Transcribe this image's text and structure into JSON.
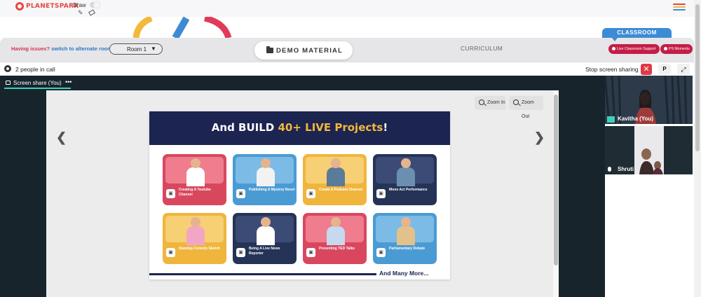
{
  "brand": {
    "name": "PLANETSPARK"
  },
  "toolbar": {
    "draw_label": "Draw"
  },
  "connection": {
    "issue_prefix": "Having issues?",
    "issue_link": "switch to alternate room",
    "room": "Room 1"
  },
  "nav": {
    "demo_material": "DEMO MATERIAL",
    "curriculum": "CURRICULUM",
    "classroom": "CLASSROOM",
    "live_support": "Live Classroom Support",
    "ps_moments": "PS Moments"
  },
  "call": {
    "people_count": "2 people in call",
    "stop_sharing": "Stop screen sharing",
    "p_label": "P"
  },
  "share": {
    "tab_label": "Screen share (You)",
    "more": "•••",
    "zoom_in": "Zoom In",
    "zoom_out": "Zoom Out"
  },
  "slide": {
    "title_prefix": "And BUILD",
    "title_highlight": "40+ LIVE Projects",
    "title_suffix": "!",
    "cards": [
      {
        "label": "Creating A Youtube Channel",
        "bg": "#d9475f",
        "inner": "#ef7d8e",
        "shirt": "#ffffff"
      },
      {
        "label": "Publishing A Mystery Novel",
        "bg": "#4a9bd4",
        "inner": "#7cbbe6",
        "shirt": "#f2f2f2"
      },
      {
        "label": "Create A Podcast Channel",
        "bg": "#f0b53d",
        "inner": "#f7cf74",
        "shirt": "#5a7b9a"
      },
      {
        "label": "Mono Act Performance",
        "bg": "#253357",
        "inner": "#3c4b76",
        "shirt": "#6b8fb0"
      },
      {
        "label": "Standup Comedy Sketch",
        "bg": "#f0b53d",
        "inner": "#f7cf74",
        "shirt": "#f3a6c4"
      },
      {
        "label": "Being A Live News Reporter",
        "bg": "#253357",
        "inner": "#3c4b76",
        "shirt": "#ffffff"
      },
      {
        "label": "Presenting TED Talks",
        "bg": "#d9475f",
        "inner": "#ef7d8e",
        "shirt": "#c7d9ee"
      },
      {
        "label": "Parliamentary Debate",
        "bg": "#4a9bd4",
        "inner": "#7cbbe6",
        "shirt": "#e2c28a"
      }
    ],
    "more": "And Many More..."
  },
  "participants": [
    {
      "name": "Kavitha (You)"
    },
    {
      "name": "Shruti"
    }
  ],
  "colors": {
    "brand_red": "#e8463f",
    "accent_teal": "#3fd0b8",
    "classroom_blue": "#3d8bd4",
    "pill_red": "#c41e47",
    "stop_red": "#e03a44",
    "slide_navy": "#1c2450",
    "slide_gold": "#f2b93b"
  }
}
